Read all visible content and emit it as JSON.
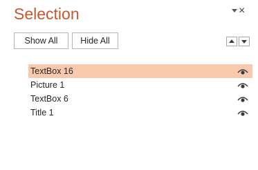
{
  "pane": {
    "title": "Selection",
    "close_glyph": "×",
    "dropdown_icon": "chevron-down-icon",
    "close_icon": "close-icon"
  },
  "toolbar": {
    "show_all_label": "Show All",
    "hide_all_label": "Hide All",
    "bring_forward_icon": "triangle-up-icon",
    "send_backward_icon": "triangle-down-icon"
  },
  "items": [
    {
      "label": "TextBox 16",
      "selected": true,
      "visible": true
    },
    {
      "label": "Picture 1",
      "selected": false,
      "visible": true
    },
    {
      "label": "TextBox 6",
      "selected": false,
      "visible": true
    },
    {
      "label": "Title 1",
      "selected": false,
      "visible": true
    }
  ],
  "colors": {
    "title": "#c5592e",
    "selected_row": "#f9c9ae",
    "text": "#262626"
  }
}
